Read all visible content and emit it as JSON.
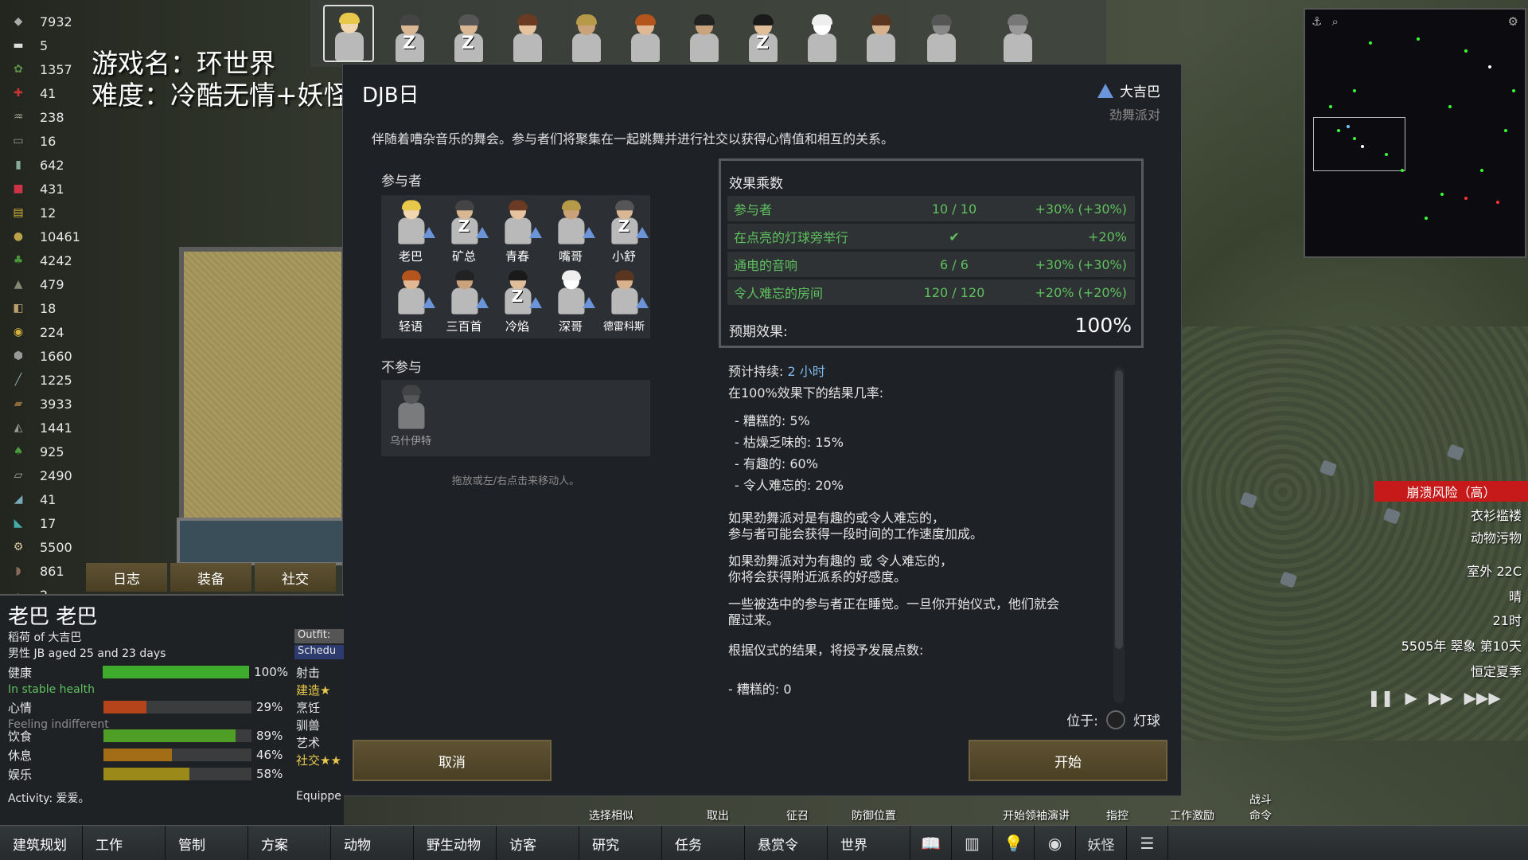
{
  "resources": [
    {
      "icon": "silver-icon",
      "value": "7932"
    },
    {
      "icon": "beer-icon",
      "value": "5"
    },
    {
      "icon": "herbal-icon",
      "value": "1357"
    },
    {
      "icon": "medicine-icon",
      "value": "41"
    },
    {
      "icon": "hay-icon",
      "value": "238"
    },
    {
      "icon": "cloth-icon",
      "value": "16"
    },
    {
      "icon": "bottles-icon",
      "value": "642"
    },
    {
      "icon": "jar-icon",
      "value": "431"
    },
    {
      "icon": "corn-icon",
      "value": "12"
    },
    {
      "icon": "potato-icon",
      "value": "10461"
    },
    {
      "icon": "vegetable-icon",
      "value": "4242"
    },
    {
      "icon": "pile-icon",
      "value": "479"
    },
    {
      "icon": "pack-icon",
      "value": "18"
    },
    {
      "icon": "gold-icon",
      "value": "224"
    },
    {
      "icon": "stone-icon",
      "value": "1660"
    },
    {
      "icon": "feather-icon",
      "value": "1225"
    },
    {
      "icon": "wood-icon",
      "value": "3933"
    },
    {
      "icon": "chunk-icon",
      "value": "1441"
    },
    {
      "icon": "leaves-icon",
      "value": "925"
    },
    {
      "icon": "steel-icon",
      "value": "2490"
    },
    {
      "icon": "plasteel-icon",
      "value": "41"
    },
    {
      "icon": "jade-icon",
      "value": "17"
    },
    {
      "icon": "component-icon",
      "value": "5500"
    },
    {
      "icon": "logs-icon",
      "value": "861"
    },
    {
      "icon": "misc-icon",
      "value": "2"
    }
  ],
  "overlay": {
    "line1": "游戏名：环世界",
    "line2": "难度：冷酷无情+妖怪村"
  },
  "colonist_bar": [
    {
      "hair": "#e8c84a",
      "skin": "#f0d7b0",
      "sleep": false,
      "selected": true
    },
    {
      "hair": "#444",
      "skin": "#d9b792",
      "sleep": true,
      "selected": false
    },
    {
      "hair": "#555",
      "skin": "#d9b792",
      "sleep": true,
      "selected": false
    },
    {
      "hair": "#6a3a22",
      "skin": "#e6c29e",
      "sleep": false,
      "selected": false
    },
    {
      "hair": "#b69a4a",
      "skin": "#c9a27a",
      "sleep": false,
      "selected": false
    },
    {
      "hair": "#b5551e",
      "skin": "#e0b894",
      "sleep": false,
      "selected": false
    },
    {
      "hair": "#222",
      "skin": "#caa27c",
      "sleep": false,
      "selected": false
    },
    {
      "hair": "#1a1a1a",
      "skin": "#e0be9a",
      "sleep": true,
      "selected": false
    },
    {
      "hair": "#eeeeee",
      "skin": "#ffffff",
      "sleep": false,
      "selected": false
    },
    {
      "hair": "#5a3520",
      "skin": "#d8b28c",
      "sleep": false,
      "selected": false
    },
    {
      "hair": "#555",
      "skin": "#888",
      "sleep": false,
      "selected": false
    },
    {
      "hair": "#777",
      "skin": "#999",
      "sleep": false,
      "selected": false
    }
  ],
  "dialog": {
    "title": "DJB日",
    "author": "大吉巴",
    "ritual_type": "劲舞派对",
    "description": "伴随着嘈杂音乐的舞会。参与者们将聚集在一起跳舞并进行社交以获得心情值和相互的关系。",
    "participants_label": "参与者",
    "participants": [
      {
        "name": "老巴",
        "hair": "#e8c84a",
        "skin": "#f0d7b0",
        "sleep": false
      },
      {
        "name": "矿总",
        "hair": "#444",
        "skin": "#d9b792",
        "sleep": true
      },
      {
        "name": "青春",
        "hair": "#6a3a22",
        "skin": "#e6c29e",
        "sleep": false
      },
      {
        "name": "嘴哥",
        "hair": "#b69a4a",
        "skin": "#c9a27a",
        "sleep": false
      },
      {
        "name": "小舒",
        "hair": "#555",
        "skin": "#d9b792",
        "sleep": true
      },
      {
        "name": "轻语",
        "hair": "#b5551e",
        "skin": "#e0b894",
        "sleep": false
      },
      {
        "name": "三百首",
        "hair": "#222",
        "skin": "#caa27c",
        "sleep": false
      },
      {
        "name": "冷焰",
        "hair": "#1a1a1a",
        "skin": "#e0be9a",
        "sleep": true
      },
      {
        "name": "深哥",
        "hair": "#eeeeee",
        "skin": "#ffffff",
        "sleep": false
      },
      {
        "name": "德雷科斯",
        "hair": "#5a3520",
        "skin": "#d8b28c",
        "sleep": false
      }
    ],
    "nonparticipants_label": "不参与",
    "nonparticipants": [
      {
        "name": "乌什伊特"
      }
    ],
    "drag_hint": "拖放或左/右点击来移动人。",
    "effects_title": "效果乘数",
    "effects": [
      {
        "label": "参与者",
        "value": "10 / 10",
        "bonus": "+30%  (+30%)"
      },
      {
        "label": "在点亮的灯球旁举行",
        "value": "✔",
        "bonus": "+20%"
      },
      {
        "label": "通电的音响",
        "value": "6 / 6",
        "bonus": "+30%  (+30%)"
      },
      {
        "label": "令人难忘的房间",
        "value": "120 / 120",
        "bonus": "+20%  (+20%)"
      }
    ],
    "expected_label": "预期效果:",
    "expected_value": "100%",
    "duration_label": "预计持续: ",
    "duration_value": "2 小时",
    "chance_label": "在100%效果下的结果几率:",
    "outcomes": [
      "- 糟糕的: 5%",
      "- 枯燥乏味的: 15%",
      "- 有趣的: 60%",
      "- 令人难忘的: 20%"
    ],
    "note1a": "如果劲舞派对是有趣的或令人难忘的，",
    "note1b": "参与者可能会获得一段时间的工作速度加成。",
    "note2a": "如果劲舞派对为有趣的 或 令人难忘的，",
    "note2b": "你将会获得附近派系的好感度。",
    "note3a": "一些被选中的参与者正在睡觉。一旦你开始仪式，他们就会",
    "note3b": "醒过来。",
    "points_label": "根据仪式的结果，将授予发展点数:",
    "points_first": "- 糟糕的: 0",
    "location_label": "位于:",
    "location_value": "灯球",
    "cancel": "取消",
    "start": "开始"
  },
  "inspect": {
    "tabs": [
      "日志",
      "装备",
      "社交"
    ],
    "name": "老巴 老巴",
    "faction": "稻荷 of 大吉巴",
    "desc": "男性 JB aged 25 and 23 days",
    "outfit": "Outfit: 仕",
    "schedule": "Schedu",
    "needs": [
      {
        "label": "健康",
        "pct": "100%",
        "fill": 1.0,
        "color": "#3dab2c"
      },
      {
        "label": "心情",
        "pct": "29%",
        "fill": 0.29,
        "color": "#b5441b"
      },
      {
        "label": "饮食",
        "pct": "89%",
        "fill": 0.89,
        "color": "#4f9e25"
      },
      {
        "label": "休息",
        "pct": "46%",
        "fill": 0.46,
        "color": "#a36d15"
      },
      {
        "label": "娱乐",
        "pct": "58%",
        "fill": 0.58,
        "color": "#9b8a1a"
      }
    ],
    "health_sub": "In stable health",
    "mood_sub": "Feeling indifferent",
    "skills": [
      "射击",
      "建造★",
      "烹饪",
      "驯兽",
      "艺术",
      "社交★★"
    ],
    "activity": "Activity: 爱爱。",
    "equipped": "Equippe"
  },
  "status": {
    "collapse": "崩溃风险（高）",
    "items": [
      "衣衫褴褛",
      "动物污物",
      "室外 22C",
      "晴",
      "21时",
      "5505年 翠象 第10天",
      "恒定夏季"
    ]
  },
  "commands": [
    "选择相似",
    "取出",
    "征召",
    "防御位置",
    "开始领袖演讲",
    "指控",
    "工作激励",
    "战斗命令"
  ],
  "bottom_bar": [
    "建筑规划",
    "工作",
    "管制",
    "方案",
    "动物",
    "野生动物",
    "访客",
    "研究",
    "任务",
    "悬赏令",
    "世界"
  ],
  "bottom_icons": [
    "book-icon",
    "stats-icon",
    "idea-icon",
    "ideology-icon",
    "menu-icon"
  ],
  "bottom_extra": "妖怪",
  "colors": {
    "accent_green": "#5fc05f",
    "button": "#5f5233",
    "danger": "#c61a1a"
  }
}
